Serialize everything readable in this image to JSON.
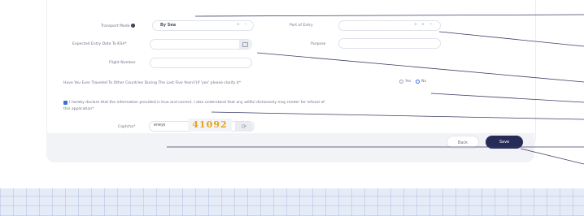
{
  "form": {
    "transport_mode": {
      "label": "Transport Mode",
      "info_icon": "i",
      "value": "By Sea",
      "clear_icon": "×",
      "chevron_icon": "⌄"
    },
    "port_of_entry": {
      "label": "Port of Entry",
      "value": "",
      "clear_icon": "×",
      "chevron_icon": "⌄"
    },
    "expected_entry_date": {
      "label": "Expected Entry Date To KSA",
      "required": "*",
      "value": "",
      "calendar_icon": "calendar-icon"
    },
    "purpose": {
      "label": "Purpose",
      "value": ""
    },
    "flight_number": {
      "label": "Flight Number",
      "value": ""
    },
    "travel_question": {
      "label": "Have You Ever Traveled To Other Countries During The Last Five Years?(if 'yes' please clarify it",
      "required": "*",
      "options": [
        "Yes",
        "No"
      ],
      "selected": "No"
    },
    "declaration": {
      "checked": true,
      "text_line1": "I hereby declare that the information provided is true and correct. I also understand that any willful dishonesty may render for refusal of",
      "text_line2": "this application",
      "required": "*"
    },
    "captcha": {
      "label": "Captcha",
      "required": "*",
      "input_value": "eneys",
      "image_text": "41092",
      "refresh_icon": "⟳"
    }
  },
  "footer": {
    "back_label": "Back",
    "save_label": "Save"
  },
  "colors": {
    "accent": "#3d6fd8",
    "save_button": "#262b57",
    "required": "#e0445c",
    "captcha_text": "#e8a11a"
  }
}
